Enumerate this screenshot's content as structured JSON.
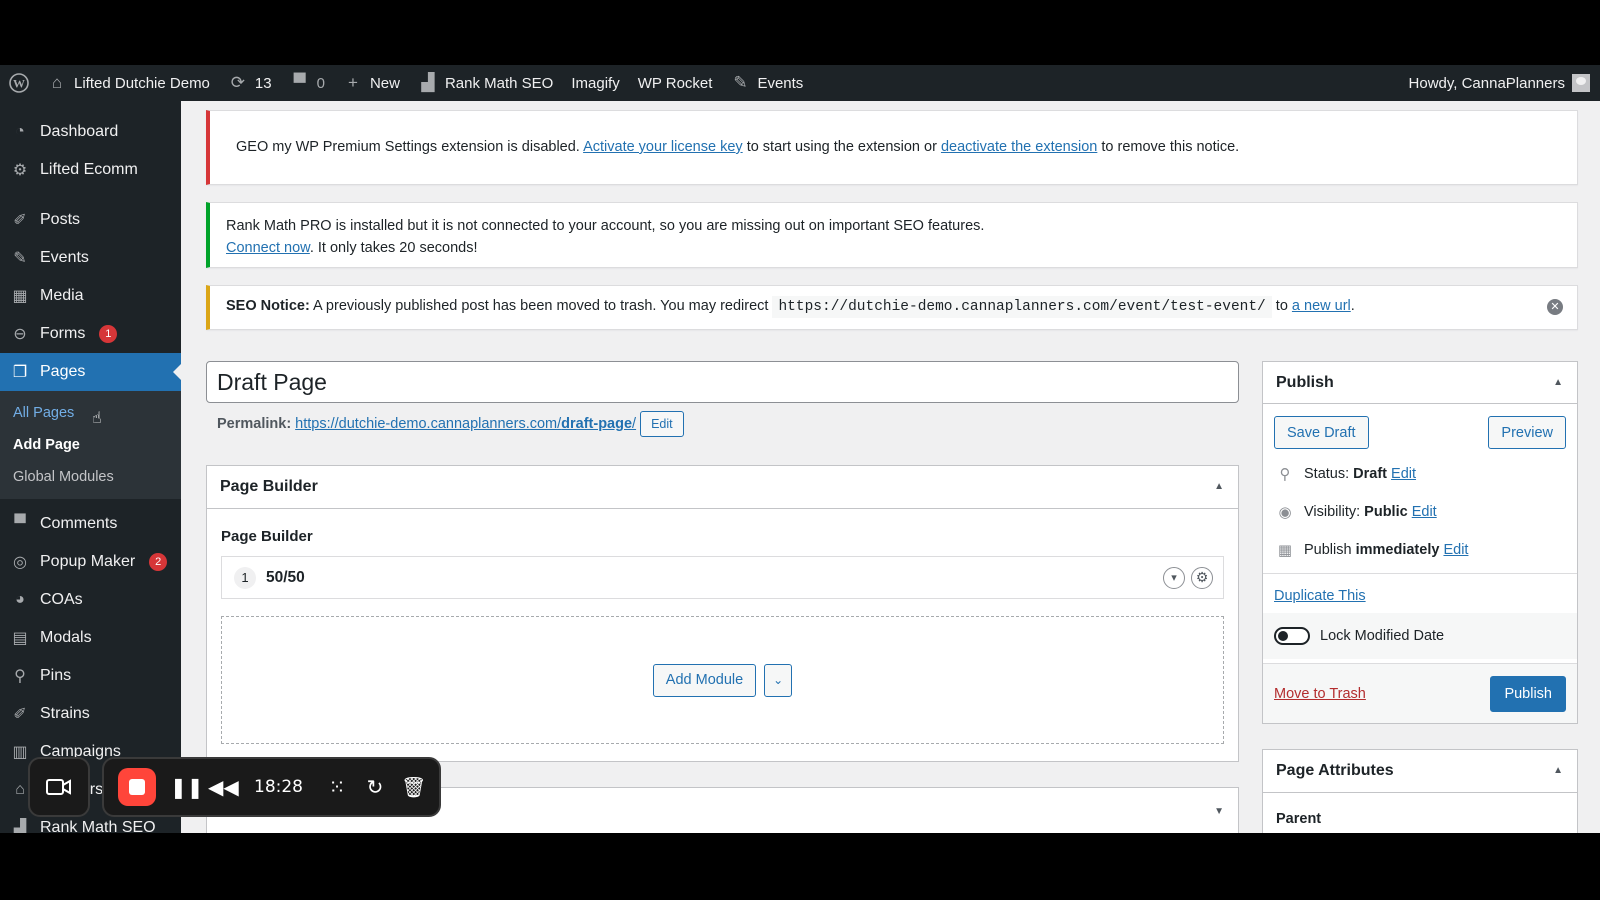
{
  "adminbar": {
    "site_name": "Lifted Dutchie Demo",
    "updates_count": "13",
    "comments_count": "0",
    "new_label": "New",
    "rankmath_label": "Rank Math SEO",
    "imagify_label": "Imagify",
    "wprocket_label": "WP Rocket",
    "events_label": "Events",
    "howdy": "Howdy, CannaPlanners"
  },
  "sidebar": {
    "items": [
      {
        "label": "Dashboard",
        "icon": "dashboard-icon"
      },
      {
        "label": "Lifted Ecomm",
        "icon": "gear-icon"
      },
      {
        "label": "Posts",
        "icon": "pin-icon"
      },
      {
        "label": "Events",
        "icon": "ticket-icon"
      },
      {
        "label": "Media",
        "icon": "media-icon"
      },
      {
        "label": "Forms",
        "icon": "forms-icon",
        "badge": "1"
      },
      {
        "label": "Pages",
        "icon": "pages-icon"
      },
      {
        "label": "Comments",
        "icon": "comment-icon"
      },
      {
        "label": "Popup Maker",
        "icon": "popup-icon",
        "badge": "2"
      },
      {
        "label": "COAs",
        "icon": "pie-icon"
      },
      {
        "label": "Modals",
        "icon": "modal-icon"
      },
      {
        "label": "Pins",
        "icon": "location-icon"
      },
      {
        "label": "Strains",
        "icon": "pin-icon"
      },
      {
        "label": "Campaigns",
        "icon": "chart-icon"
      },
      {
        "label": "Retailers",
        "icon": "store-icon"
      },
      {
        "label": "Rank Math SEO",
        "icon": "rankmath-icon"
      }
    ],
    "submenu": [
      "All Pages",
      "Add Page",
      "Global Modules"
    ]
  },
  "notices": {
    "geo_text_1": "GEO my WP Premium Settings extension is disabled.",
    "geo_link_1": "Activate your license key",
    "geo_text_2": "to start using the extension or",
    "geo_link_2": "deactivate the extension",
    "geo_text_3": "to remove this notice.",
    "rankmath_text": "Rank Math PRO is installed but it is not connected to your account, so you are missing out on important SEO features.",
    "rankmath_link": "Connect now",
    "rankmath_text_2": ". It only takes 20 seconds!",
    "seo_label": "SEO Notice:",
    "seo_text": "A previously published post has been moved to trash. You may redirect",
    "seo_code": "https://dutchie-demo.cannaplanners.com/event/test-event/",
    "seo_to": "to",
    "seo_link": "a new url",
    "seo_end": "."
  },
  "editor": {
    "title": "Draft Page",
    "permalink_label": "Permalink:",
    "permalink_base": "https://dutchie-demo.cannaplanners.com/",
    "permalink_slug": "draft-page",
    "permalink_end": "/",
    "permalink_edit": "Edit"
  },
  "page_builder": {
    "header": "Page Builder",
    "label": "Page Builder",
    "row_number": "1",
    "row_name": "50/50",
    "add_module": "Add Module"
  },
  "publish": {
    "header": "Publish",
    "save_draft": "Save Draft",
    "preview": "Preview",
    "status_label": "Status:",
    "status_value": "Draft",
    "visibility_label": "Visibility:",
    "visibility_value": "Public",
    "publish_label": "Publish",
    "publish_value": "immediately",
    "edit": "Edit",
    "duplicate": "Duplicate This",
    "lock_modified": "Lock Modified Date",
    "move_to_trash": "Move to Trash",
    "publish_button": "Publish"
  },
  "attributes": {
    "header": "Page Attributes",
    "parent_label": "Parent"
  },
  "recorder": {
    "time": "18:28"
  }
}
